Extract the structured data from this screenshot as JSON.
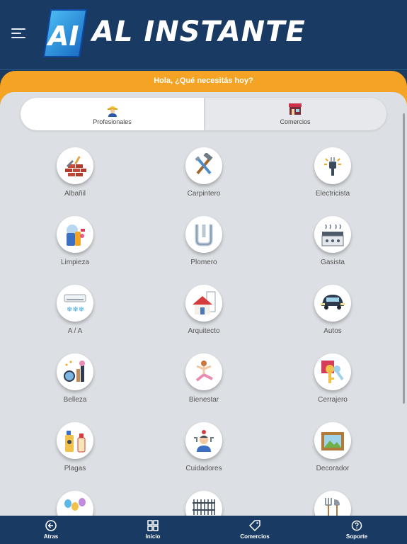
{
  "header": {
    "logo_mark": "AI",
    "title": "AL INSTANTE"
  },
  "greeting": "Hola, ¿Qué necesitás hoy?",
  "tabs": [
    {
      "label": "Profesionales",
      "icon": "worker-icon",
      "active": true
    },
    {
      "label": "Comercios",
      "icon": "store-icon",
      "active": false
    }
  ],
  "categories": [
    {
      "label": "Albañil",
      "icon": "bricklayer-icon"
    },
    {
      "label": "Carpintero",
      "icon": "carpenter-tools-icon"
    },
    {
      "label": "Electricista",
      "icon": "electric-plug-icon"
    },
    {
      "label": "Limpieza",
      "icon": "cleaning-supplies-icon"
    },
    {
      "label": "Plomero",
      "icon": "pipe-icon"
    },
    {
      "label": "Gasista",
      "icon": "gas-stove-icon"
    },
    {
      "label": "A / A",
      "icon": "air-conditioner-icon"
    },
    {
      "label": "Arquitecto",
      "icon": "house-blueprint-icon"
    },
    {
      "label": "Autos",
      "icon": "car-icon"
    },
    {
      "label": "Belleza",
      "icon": "beauty-icon"
    },
    {
      "label": "Bienestar",
      "icon": "yoga-icon"
    },
    {
      "label": "Cerrajero",
      "icon": "key-icon"
    },
    {
      "label": "Plagas",
      "icon": "pest-spray-icon"
    },
    {
      "label": "Cuidadores",
      "icon": "caregiver-icon"
    },
    {
      "label": "Decorador",
      "icon": "picture-frame-icon"
    },
    {
      "label": "",
      "icon": "balloons-icon"
    },
    {
      "label": "",
      "icon": "fence-icon"
    },
    {
      "label": "",
      "icon": "garden-tools-icon"
    }
  ],
  "bottom_nav": [
    {
      "label": "Atras",
      "icon": "back-arrow-icon"
    },
    {
      "label": "Inicio",
      "icon": "grid-icon"
    },
    {
      "label": "Comercios",
      "icon": "tag-icon"
    },
    {
      "label": "Soporte",
      "icon": "help-icon"
    }
  ],
  "colors": {
    "header": "#193a63",
    "accent": "#f4a324",
    "background": "#dcdfe3",
    "logo_blue": "#1e88e5"
  }
}
